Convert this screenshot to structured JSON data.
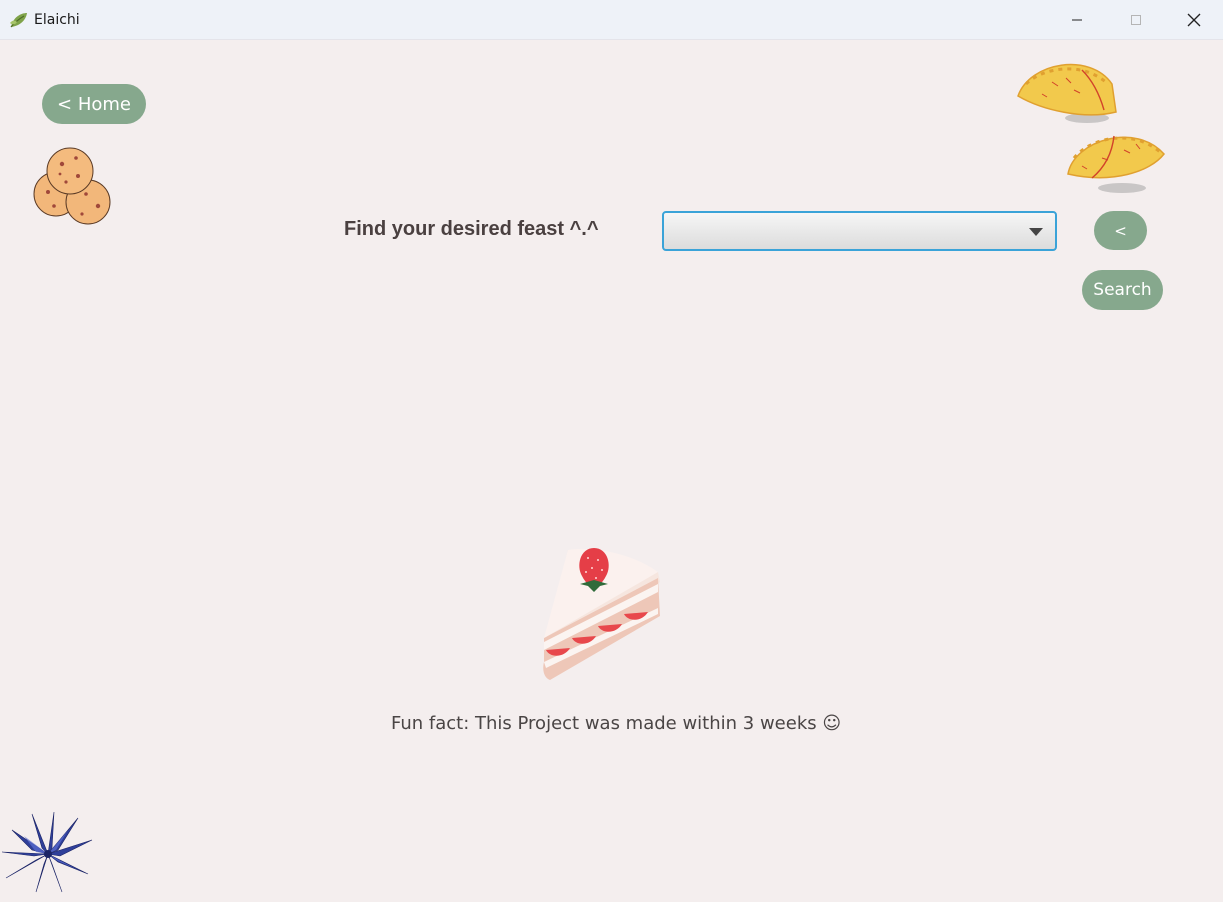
{
  "window": {
    "title": "Elaichi",
    "app_icon": "leaf-icon",
    "controls": {
      "minimize_icon": "minimize-icon",
      "maximize_icon": "maximize-icon",
      "close_icon": "close-icon"
    }
  },
  "nav": {
    "home_label": "< Home",
    "back_label": "<"
  },
  "search": {
    "prompt": "Find your desired feast ^.^",
    "dropdown_value": "",
    "button_label": "Search"
  },
  "footer": {
    "fun_fact": "Fun fact: This Project was made within 3 weeks ☺"
  },
  "decorations": [
    "cookies-illustration",
    "empanadas-illustration",
    "strawberry-cake-illustration",
    "blue-plant-illustration"
  ],
  "colors": {
    "background": "#f4eeee",
    "button": "#86a88d",
    "dropdown_focus": "#3aa3d8",
    "label_text": "#4a4040"
  }
}
